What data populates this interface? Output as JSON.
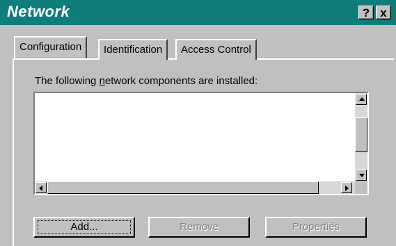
{
  "window": {
    "title": "Network",
    "help_label": "?",
    "close_label": "x"
  },
  "tabs": [
    {
      "label": "Configuration",
      "active": true
    },
    {
      "label": "Identification",
      "active": false
    },
    {
      "label": "Access Control",
      "active": false
    }
  ],
  "installed_label": {
    "before": "The following ",
    "underlined": "n",
    "after": "etwork components are installed:"
  },
  "components_list": [],
  "buttons": {
    "add": {
      "label": "Add...",
      "enabled": true
    },
    "remove": {
      "label": "Remove",
      "enabled": false
    },
    "properties": {
      "label": "Properties",
      "enabled": false
    }
  },
  "colors": {
    "titlebar": "#0f7d7a",
    "face": "#c0c0c0"
  }
}
